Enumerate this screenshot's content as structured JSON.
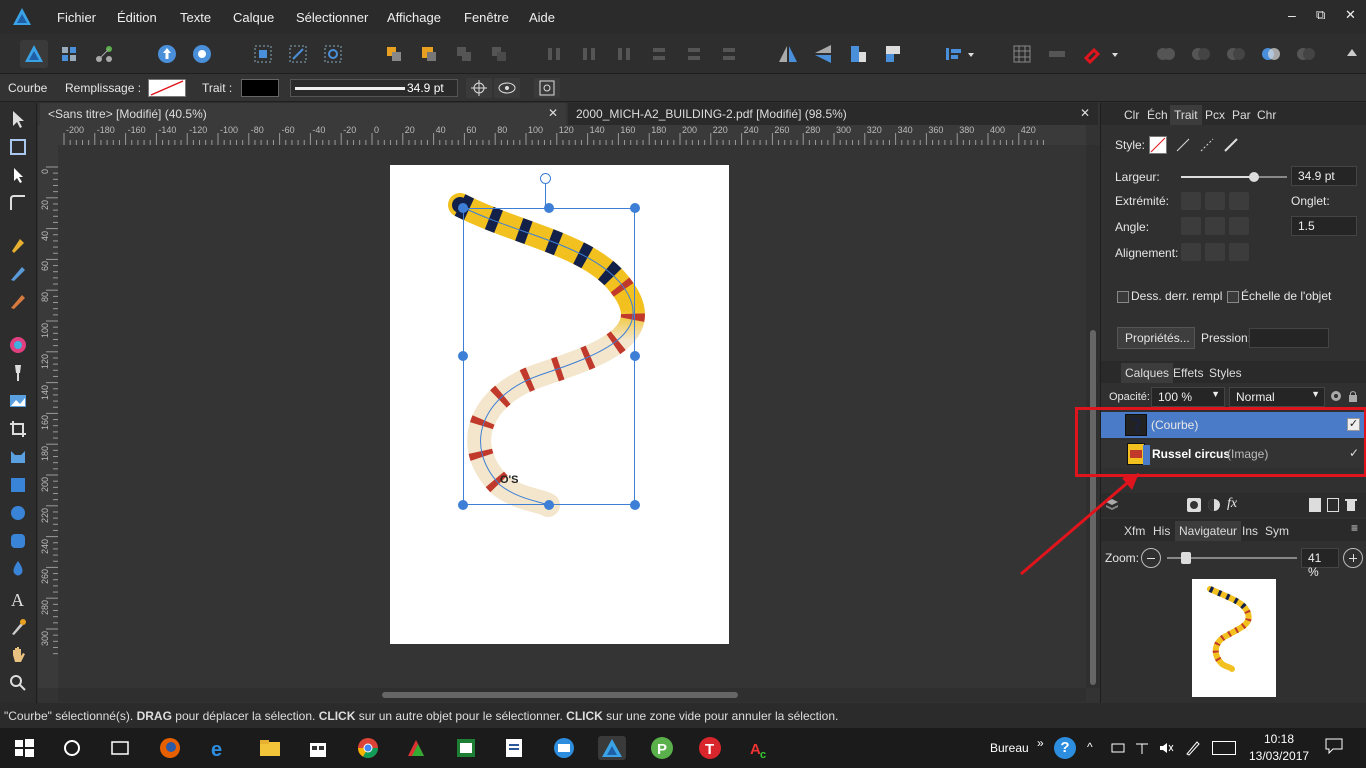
{
  "menubar": {
    "items": [
      "Fichier",
      "Édition",
      "Texte",
      "Calque",
      "Sélectionner",
      "Affichage",
      "Fenêtre",
      "Aide"
    ],
    "window_controls": [
      "–",
      "⧉",
      "✕"
    ]
  },
  "context": {
    "tool_name": "Courbe",
    "fill_label": "Remplissage :",
    "stroke_label": "Trait :",
    "stroke_width": "34.9 pt"
  },
  "documents": {
    "tabs": [
      {
        "label": "<Sans titre> [Modifié] (40.5%)",
        "close": "✕"
      },
      {
        "label": "2000_MICH-A2_BUILDING-2.pdf [Modifié] (98.5%)",
        "close": "✕"
      }
    ]
  },
  "ruler": {
    "labels": [
      "-200",
      "-180",
      "-160",
      "-140",
      "-120",
      "-100",
      "-80",
      "-60",
      "-40",
      "-20",
      "0",
      "20",
      "40",
      "60",
      "80",
      "100",
      "120",
      "140",
      "160",
      "180",
      "200",
      "220",
      "240",
      "260",
      "280",
      "300",
      "320",
      "340",
      "360",
      "380",
      "400",
      "420"
    ],
    "vlabels": [
      "0",
      "20",
      "40",
      "60",
      "80",
      "100",
      "120",
      "140",
      "160",
      "180",
      "200",
      "220",
      "240",
      "260",
      "280",
      "300"
    ]
  },
  "stroke_panel": {
    "tabs": [
      "Clr",
      "Éch",
      "Trait",
      "Pcx",
      "Par",
      "Chr"
    ],
    "style_label": "Style:",
    "width_label": "Largeur:",
    "width_value": "34.9 pt",
    "cap_label": "Extrémité:",
    "join_label": "Angle:",
    "miter_label": "Onglet:",
    "miter_value": "1.5",
    "align_label": "Alignement:",
    "behind_fill": "Dess. derr. rempl",
    "scale_obj": "Échelle de l'objet",
    "props_button": "Propriétés...",
    "pressure_label": "Pression:"
  },
  "layers_panel": {
    "tabs": [
      "Calques",
      "Effets",
      "Styles"
    ],
    "opacity_label": "Opacité:",
    "opacity_value": "100 %",
    "blend_mode": "Normal",
    "layers": [
      {
        "name": "(Courbe)",
        "suffix": "",
        "selected": true,
        "checked": "✓"
      },
      {
        "name": "Russel circus",
        "suffix": " (Image)",
        "selected": false,
        "checked": "✓"
      }
    ]
  },
  "nav_panel": {
    "tabs": [
      "Xfm",
      "His",
      "Navigateur",
      "Ins",
      "Sym"
    ],
    "zoom_label": "Zoom:",
    "zoom_value": "41 %",
    "zoom_level": 0.41
  },
  "status": {
    "part1": "\"Courbe\" sélectionné(s). ",
    "drag": "DRAG",
    "part2": " pour déplacer la sélection. ",
    "click1": "CLICK",
    "part3": " sur un autre objet pour le sélectionner. ",
    "click2": "CLICK",
    "part4": " sur une zone vide pour annuler la sélection."
  },
  "taskbar": {
    "desktop_label": "Bureau",
    "time": "10:18",
    "date": "13/03/2017",
    "help": "?"
  },
  "colors": {
    "accent": "#3d7fd6",
    "layer_selected": "#4a7bc8",
    "annotation": "#e0141c"
  }
}
